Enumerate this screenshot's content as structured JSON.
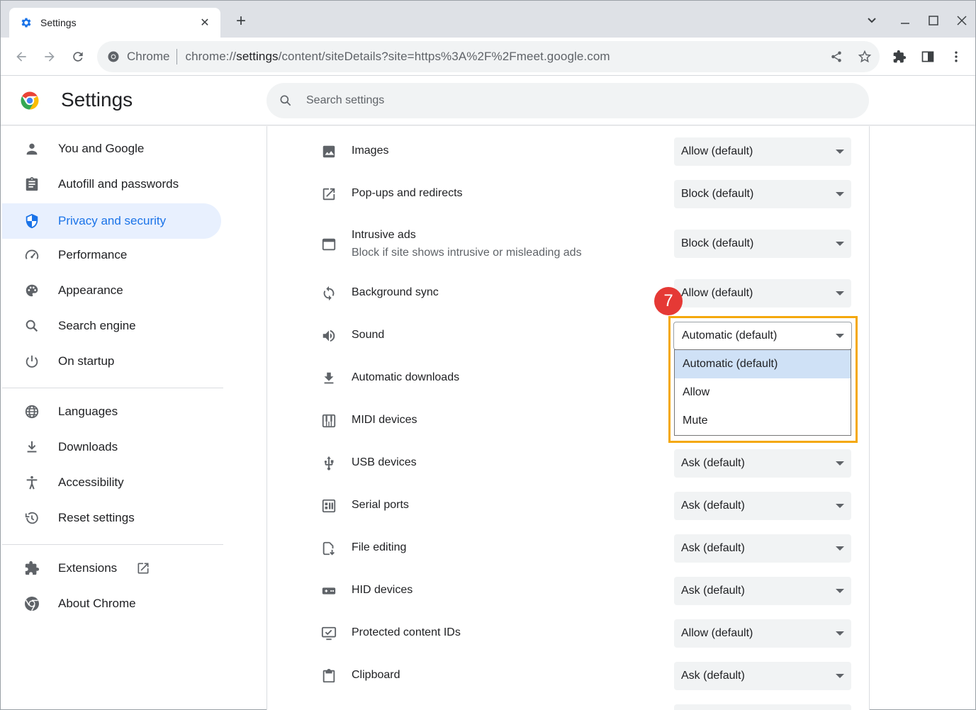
{
  "browser": {
    "tab_title": "Settings",
    "tab_close": "✕",
    "new_tab": "+",
    "omnibox_chip": "Chrome",
    "url_prefix": "chrome://",
    "url_host": "settings",
    "url_path": "/content/siteDetails?site=https%3A%2F%2Fmeet.google.com"
  },
  "header": {
    "title": "Settings",
    "search_placeholder": "Search settings"
  },
  "sidebar": {
    "items": [
      {
        "label": "You and Google",
        "icon": "person-icon"
      },
      {
        "label": "Autofill and passwords",
        "icon": "clipboard-icon"
      },
      {
        "label": "Privacy and security",
        "icon": "shield-icon",
        "active": true
      },
      {
        "label": "Performance",
        "icon": "speedometer-icon"
      },
      {
        "label": "Appearance",
        "icon": "palette-icon"
      },
      {
        "label": "Search engine",
        "icon": "search-icon"
      },
      {
        "label": "On startup",
        "icon": "power-icon"
      },
      {
        "label": "Languages",
        "icon": "globe-icon"
      },
      {
        "label": "Downloads",
        "icon": "download-icon"
      },
      {
        "label": "Accessibility",
        "icon": "accessibility-icon"
      },
      {
        "label": "Reset settings",
        "icon": "history-icon"
      },
      {
        "label": "Extensions",
        "icon": "puzzle-icon"
      },
      {
        "label": "About Chrome",
        "icon": "chrome-icon"
      }
    ]
  },
  "permissions": [
    {
      "label": "Images",
      "value": "Allow (default)",
      "icon": "image-icon"
    },
    {
      "label": "Pop-ups and redirects",
      "value": "Block (default)",
      "icon": "open-in-new-icon"
    },
    {
      "label": "Intrusive ads",
      "sublabel": "Block if site shows intrusive or misleading ads",
      "value": "Block (default)",
      "icon": "window-icon"
    },
    {
      "label": "Background sync",
      "value": "Allow (default)",
      "icon": "sync-icon"
    },
    {
      "label": "Sound",
      "value": "Automatic (default)",
      "icon": "volume-icon"
    },
    {
      "label": "Automatic downloads",
      "icon": "download-icon"
    },
    {
      "label": "MIDI devices",
      "icon": "piano-icon"
    },
    {
      "label": "USB devices",
      "value": "Ask (default)",
      "icon": "usb-icon"
    },
    {
      "label": "Serial ports",
      "value": "Ask (default)",
      "icon": "serial-icon"
    },
    {
      "label": "File editing",
      "value": "Ask (default)",
      "icon": "file-edit-icon"
    },
    {
      "label": "HID devices",
      "value": "Ask (default)",
      "icon": "gamepad-icon"
    },
    {
      "label": "Protected content IDs",
      "value": "Allow (default)",
      "icon": "monitor-check-icon"
    },
    {
      "label": "Clipboard",
      "value": "Ask (default)",
      "icon": "clipboard-icon"
    }
  ],
  "sound_dropdown": {
    "options": [
      "Automatic (default)",
      "Allow",
      "Mute"
    ],
    "selected": "Automatic (default)"
  },
  "step_badge": "7",
  "colors": {
    "accent": "#1a73e8",
    "highlight": "#f4a80c",
    "badge": "#e53935",
    "selected_option": "#cfe1f6"
  }
}
